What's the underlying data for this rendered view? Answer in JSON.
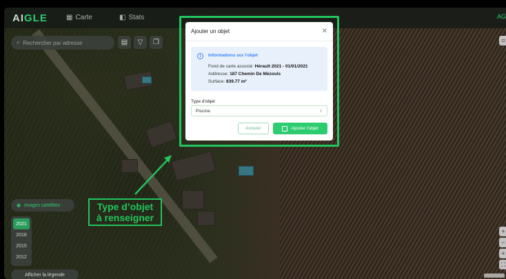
{
  "app": {
    "logo_prefix": "AI",
    "logo_accent": "GLE"
  },
  "nav": [
    {
      "label": "Carte",
      "icon": "map-icon"
    },
    {
      "label": "Stats",
      "icon": "stats-icon"
    }
  ],
  "top_right_tag": "AG",
  "search": {
    "placeholder": "Rechercher par adresse"
  },
  "left_panel": {
    "satellite_toggle": "Images satellites",
    "years": [
      "2021",
      "2018",
      "2015",
      "2012"
    ],
    "selected_year": "2021",
    "legend_button": "Afficher la légende"
  },
  "modal": {
    "title": "Ajouter un objet",
    "info": {
      "title": "Informations sur l'objet",
      "basemap_label": "Fond de carte associé:",
      "basemap_value": "Hérault 2021 - 01/01/2021",
      "address_label": "Addresse:",
      "address_value": "187 Chemin De Mézouls",
      "surface_label": "Surface:",
      "surface_value": "839.77 m²"
    },
    "type_label": "Type d'objet",
    "type_value": "Piscine",
    "cancel_label": "Annuler",
    "add_label": "Ajouter l'objet"
  },
  "annotation": {
    "line1": "Type d’objet",
    "line2": "à renseigner"
  },
  "colors": {
    "accent": "#22c55e",
    "info": "#3b82f6"
  }
}
